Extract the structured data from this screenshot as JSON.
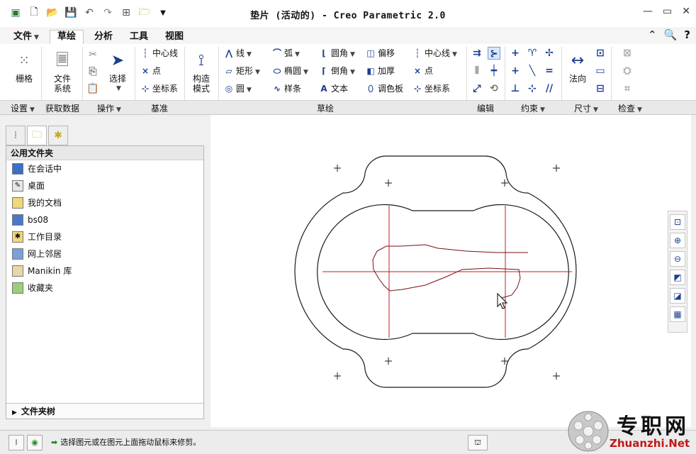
{
  "window": {
    "title": "垫片 (活动的) - Creo Parametric 2.0"
  },
  "ribbon_tabs": [
    {
      "label": "文件",
      "has_dropdown": true
    },
    {
      "label": "草绘",
      "active": true
    },
    {
      "label": "分析"
    },
    {
      "label": "工具"
    },
    {
      "label": "视图"
    }
  ],
  "ribbon": {
    "settings": {
      "label": "栅格",
      "group": "设置"
    },
    "get_data": {
      "label_line1": "文件",
      "label_line2": "系统",
      "group": "获取数据"
    },
    "operations": {
      "select_label": "选择",
      "group": "操作"
    },
    "datum": {
      "items": [
        "中心线",
        "点",
        "坐标系"
      ],
      "group": "基准"
    },
    "construct": {
      "label_line1": "构造",
      "label_line2": "模式"
    },
    "sketch": {
      "col1": [
        "线",
        "矩形",
        "圆"
      ],
      "col2": [
        "弧",
        "椭圆",
        "样条"
      ],
      "col3": [
        "圆角",
        "倒角",
        "文本"
      ],
      "col4": [
        "偏移",
        "加厚",
        "调色板"
      ],
      "col5": [
        "中心线",
        "点",
        "坐标系"
      ],
      "group": "草绘"
    },
    "edit_group": "编辑",
    "constrain_group": "约束",
    "dimension": {
      "normal_label": "法向",
      "group": "尺寸"
    },
    "inspect_group": "检查"
  },
  "left_panel": {
    "section_title": "公用文件夹",
    "folders": [
      "在会话中",
      "桌面",
      "我的文档",
      "bs08",
      "工作目录",
      "网上邻居",
      "Manikin 库",
      "收藏夹"
    ],
    "footer": "文件夹树"
  },
  "status": {
    "message": "选择图元或在图元上面拖动鼠标来修剪。"
  },
  "watermark": {
    "cn": "专职网",
    "en": "Zhuanzhi.Net"
  },
  "colors": {
    "centerline": "#cc1a1a",
    "sketch_line": "#1a1a1a",
    "freehand": "#7a0f0f",
    "accent": "#1a3f8f"
  }
}
